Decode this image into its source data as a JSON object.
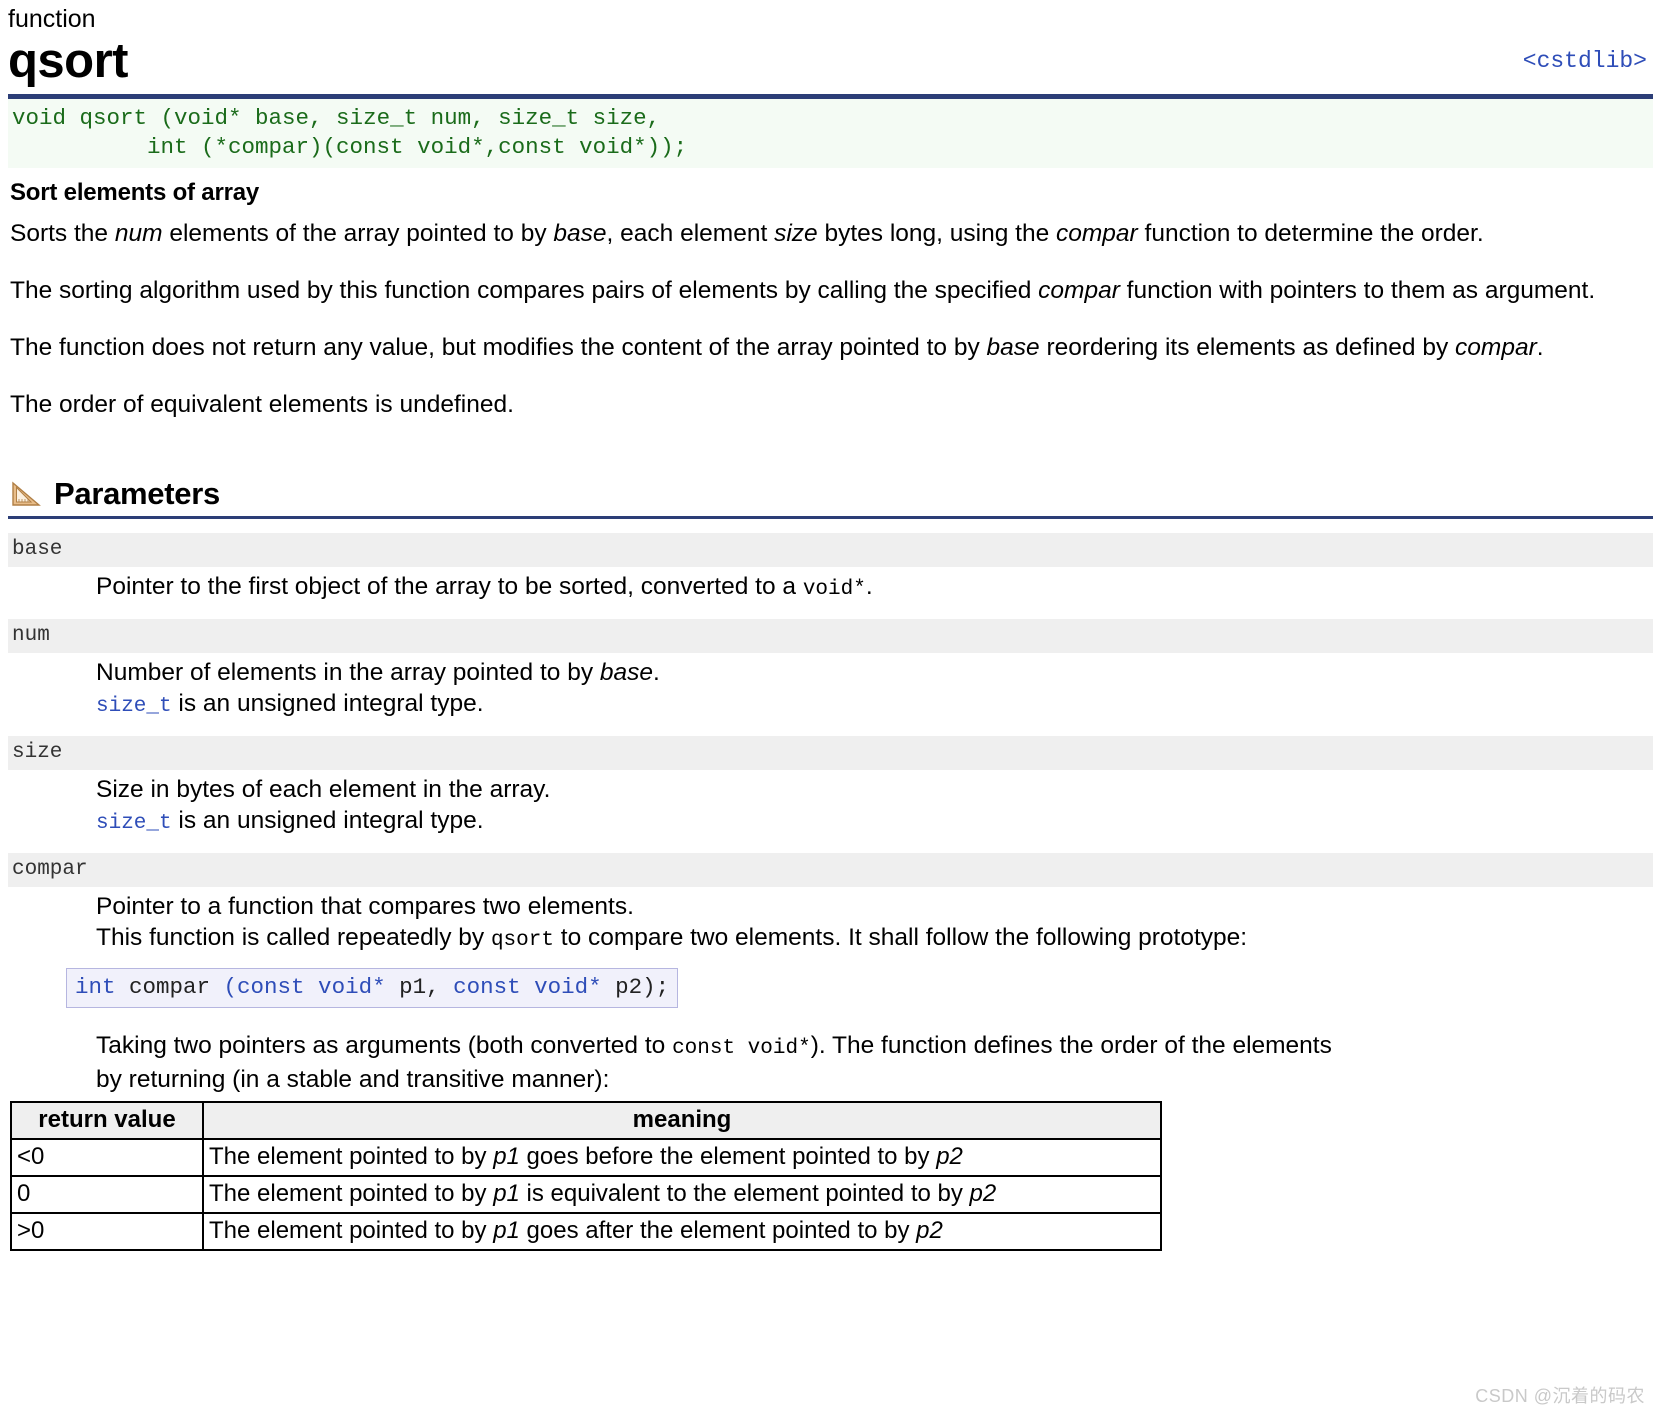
{
  "header": {
    "kind": "function",
    "name": "qsort",
    "include": "<cstdlib>"
  },
  "prototype": {
    "line1_ret": "void",
    "line1_fn": " qsort ",
    "line1_rest": "(void* base, size_t num, size_t size,",
    "line2": "          int (*compar)(const void*,const void*));",
    "full": "void qsort (void* base, size_t num, size_t size,\n          int (*compar)(const void*,const void*));"
  },
  "summary": {
    "heading": "Sort elements of array",
    "paragraphs": [
      {
        "parts": [
          {
            "t": "Sorts the ",
            "s": "n"
          },
          {
            "t": "num",
            "s": "i"
          },
          {
            "t": " elements of the array pointed to by ",
            "s": "n"
          },
          {
            "t": "base",
            "s": "i"
          },
          {
            "t": ", each element ",
            "s": "n"
          },
          {
            "t": "size",
            "s": "i"
          },
          {
            "t": " bytes long, using the ",
            "s": "n"
          },
          {
            "t": "compar",
            "s": "i"
          },
          {
            "t": " function to determine the order.",
            "s": "n"
          }
        ]
      },
      {
        "parts": [
          {
            "t": "The sorting algorithm used by this function compares pairs of elements by calling the specified ",
            "s": "n"
          },
          {
            "t": "compar",
            "s": "i"
          },
          {
            "t": " function with pointers to them as argument.",
            "s": "n"
          }
        ]
      },
      {
        "parts": [
          {
            "t": "The function does not return any value, but modifies the content of the array pointed to by ",
            "s": "n"
          },
          {
            "t": "base",
            "s": "i"
          },
          {
            "t": " reordering its elements as defined by ",
            "s": "n"
          },
          {
            "t": "compar",
            "s": "i"
          },
          {
            "t": ".",
            "s": "n"
          }
        ]
      },
      {
        "parts": [
          {
            "t": "The order of equivalent elements is undefined.",
            "s": "n"
          }
        ]
      }
    ]
  },
  "parameters_section": {
    "icon": "ruler-triangle-icon",
    "title": "Parameters"
  },
  "parameters": [
    {
      "name": "base",
      "lines": [
        [
          {
            "t": "Pointer to the first object of the array to be sorted, converted to a ",
            "s": "n"
          },
          {
            "t": "void*",
            "s": "m"
          },
          {
            "t": ".",
            "s": "n"
          }
        ]
      ]
    },
    {
      "name": "num",
      "lines": [
        [
          {
            "t": "Number of elements in the array pointed to by ",
            "s": "n"
          },
          {
            "t": "base",
            "s": "i"
          },
          {
            "t": ".",
            "s": "n"
          }
        ],
        [
          {
            "t": "size_t",
            "s": "l"
          },
          {
            "t": " is an unsigned integral type.",
            "s": "n"
          }
        ]
      ]
    },
    {
      "name": "size",
      "lines": [
        [
          {
            "t": "Size in bytes of each element in the array.",
            "s": "n"
          }
        ],
        [
          {
            "t": "size_t",
            "s": "l"
          },
          {
            "t": " is an unsigned integral type.",
            "s": "n"
          }
        ]
      ]
    },
    {
      "name": "compar",
      "lines": [
        [
          {
            "t": "Pointer to a function that compares two elements.",
            "s": "n"
          }
        ],
        [
          {
            "t": "This function is called repeatedly by ",
            "s": "n"
          },
          {
            "t": "qsort",
            "s": "m"
          },
          {
            "t": " to compare two elements. It shall follow the following prototype:",
            "s": "n"
          }
        ]
      ]
    }
  ],
  "compar_prototype": {
    "kw1": "int",
    "id1": " compar ",
    "kw2": "(const void*",
    "id2": " p1, ",
    "kw3": "const void*",
    "id3": " p2);",
    "full": "int compar (const void* p1, const void* p2);"
  },
  "compar_tail": {
    "lines": [
      [
        {
          "t": "Taking two pointers as arguments (both converted to ",
          "s": "n"
        },
        {
          "t": "const void*",
          "s": "m"
        },
        {
          "t": "). The function defines the order of the elements",
          "s": "n"
        }
      ],
      [
        {
          "t": "by returning (in a stable and transitive manner):",
          "s": "n"
        }
      ]
    ]
  },
  "return_table": {
    "headers": [
      "return value",
      "meaning"
    ],
    "rows": [
      {
        "value": "<0",
        "meaning": [
          {
            "t": "The element pointed to by ",
            "s": "n"
          },
          {
            "t": "p1",
            "s": "i"
          },
          {
            "t": " goes before the element pointed to by ",
            "s": "n"
          },
          {
            "t": "p2",
            "s": "i"
          }
        ]
      },
      {
        "value": "0",
        "meaning": [
          {
            "t": "The element pointed to by ",
            "s": "n"
          },
          {
            "t": "p1",
            "s": "i"
          },
          {
            "t": " is equivalent to the element pointed to by ",
            "s": "n"
          },
          {
            "t": "p2",
            "s": "i"
          }
        ]
      },
      {
        "value": ">0",
        "meaning": [
          {
            "t": "The element pointed to by ",
            "s": "n"
          },
          {
            "t": "p1",
            "s": "i"
          },
          {
            "t": " goes after the element pointed to by ",
            "s": "n"
          },
          {
            "t": "p2",
            "s": "i"
          }
        ]
      }
    ]
  },
  "watermark": "CSDN @沉着的码农",
  "colors": {
    "rule": "#2c3e77",
    "link": "#2e4db8",
    "prototype_bg": "#f4fbf4",
    "prototype_text": "#1a6b1a",
    "param_name_bg": "#efefef",
    "compar_box_bg": "#f1f1fb",
    "compar_box_border": "#b6b6e0",
    "table_header_bg": "#efefef",
    "watermark": "#c9c9c9"
  }
}
